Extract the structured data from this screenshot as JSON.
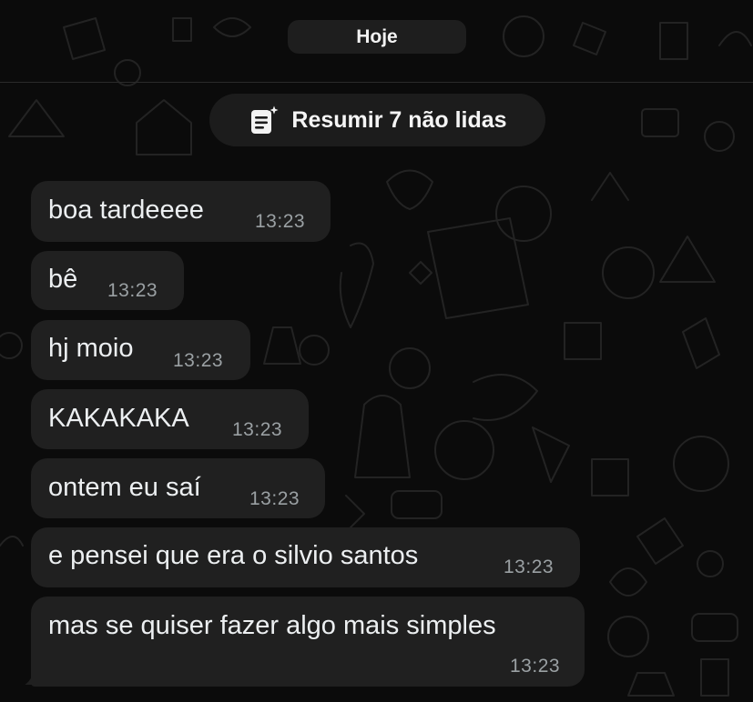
{
  "chat": {
    "date_label": "Hoje",
    "summary_button": {
      "label": "Resumir 7 não lidas",
      "icon": "summary-sparkle-note-icon"
    },
    "messages": [
      {
        "text": "boa tardeeee",
        "time": "13:23"
      },
      {
        "text": "bê",
        "time": "13:23"
      },
      {
        "text": "hj moio",
        "time": "13:23"
      },
      {
        "text": "KAKAKAKA",
        "time": "13:23"
      },
      {
        "text": "ontem eu saí",
        "time": "13:23"
      },
      {
        "text": "e pensei que era o silvio santos",
        "time": "13:23"
      },
      {
        "text": "mas se quiser fazer algo mais simples",
        "time": "13:23"
      }
    ]
  },
  "colors": {
    "background": "#0b0b0b",
    "bubble": "#202020",
    "time_text": "#9aa0a3"
  }
}
